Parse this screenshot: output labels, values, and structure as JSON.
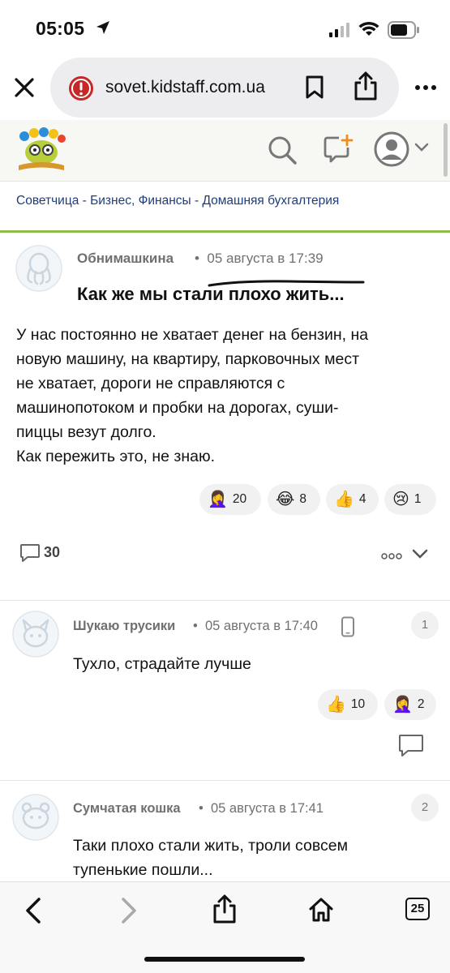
{
  "status": {
    "time": "05:05"
  },
  "browser": {
    "url": "sovet.kidstaff.com.ua",
    "tab_count": "25"
  },
  "breadcrumb": {
    "items": [
      "Советчица",
      "Бизнес, Финансы",
      "Домашняя бухгалтерия"
    ],
    "separator": " - "
  },
  "post": {
    "author": "Обнимашкина",
    "date": "05 августа в 17:39",
    "title": "Как же мы стали плохо жить...",
    "body_lines": [
      "У нас постоянно не хватает денег на бензин, на",
      "новую машину, на квартиру, парковочных мест",
      "не хватает, дороги не справляются с",
      "машинопотоком и пробки на дорогах, суши-",
      "пиццы везут долго.",
      "Как пережить это, не знаю."
    ],
    "reactions": [
      {
        "emoji": "🤦‍♀️",
        "count": "20"
      },
      {
        "emoji": "😂",
        "count": "8"
      },
      {
        "emoji": "👍",
        "count": "4"
      },
      {
        "emoji": "😢",
        "count": "1"
      }
    ],
    "comment_count": "30"
  },
  "comments": [
    {
      "number": "1",
      "author": "Шукаю трусики",
      "date": "05 августа в 17:40",
      "text": "Тухло, страдайте лучше",
      "reactions": [
        {
          "emoji": "👍",
          "count": "10"
        },
        {
          "emoji": "🤦‍♀️",
          "count": "2"
        }
      ]
    },
    {
      "number": "2",
      "author": "Сумчатая кошка",
      "date": "05 августа в 17:41",
      "text_lines": [
        "Таки плохо стали жить, троли совсем",
        "тупенькие пошли..."
      ]
    }
  ],
  "colors": {
    "accent_green": "#8dbb4c",
    "link_blue": "#1f3d7a",
    "warning_red": "#c62828"
  }
}
